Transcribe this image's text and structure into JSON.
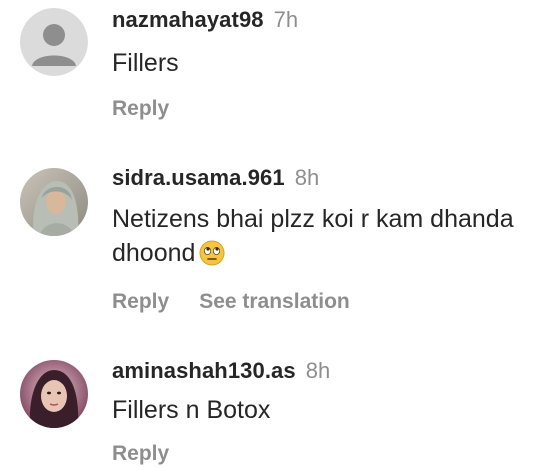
{
  "comments": [
    {
      "username": "nazmahayat98",
      "time": "7h",
      "text": "Fillers",
      "emoji": "",
      "avatar_icon": "default-avatar-icon",
      "actions": {
        "reply": "Reply"
      }
    },
    {
      "username": "sidra.usama.961",
      "time": "8h",
      "text": "Netizens bhai plzz koi r kam dhanda dhoond",
      "emoji": "🙄",
      "avatar_icon": "user-photo-hijab",
      "actions": {
        "reply": "Reply",
        "translate": "See translation"
      }
    },
    {
      "username": "aminashah130.as",
      "time": "8h",
      "text": "Fillers n Botox",
      "emoji": "",
      "avatar_icon": "user-photo-portrait",
      "actions": {
        "reply": "Reply"
      }
    }
  ],
  "colors": {
    "text": "#262626",
    "secondary": "#8e8e8e",
    "default_avatar_bg": "#dbdbdb",
    "default_avatar_fg": "#8e8e8e"
  }
}
